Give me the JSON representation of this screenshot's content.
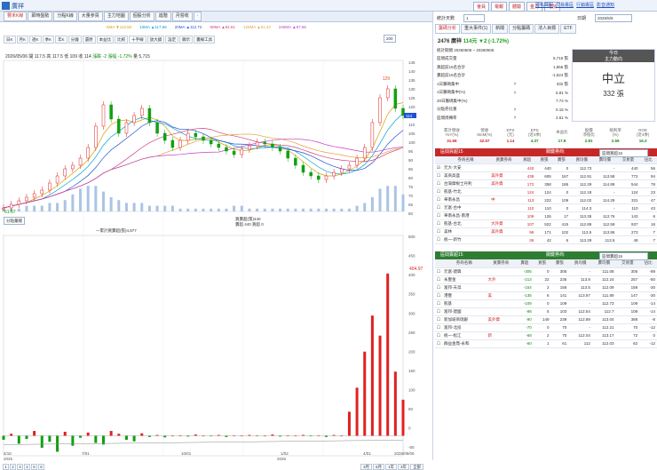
{
  "topbar": {
    "app_name": "廣祥",
    "actions": [
      "會員",
      "電報",
      "體驗",
      "金力",
      "增加"
    ],
    "links": [
      "隱私聲明",
      "交易專區",
      "行銷專區",
      "影音通知"
    ]
  },
  "left": {
    "tabs": [
      "豐禾K線",
      "即時盤勢",
      "分點K線",
      "大量參買",
      "主力地圖",
      "個股分析",
      "進階",
      "月營收",
      "·"
    ],
    "ma": [
      {
        "label": "5MA ▼113.50",
        "color": "#d8a000"
      },
      {
        "label": "10MA ▲117.65",
        "color": "#00a0d0"
      },
      {
        "label": "20MA ▲112.72",
        "color": "#2050d0"
      },
      {
        "label": "60MA ▲92.61",
        "color": "#d04080"
      },
      {
        "label": "120MA ▲91.42",
        "color": "#e0a030"
      },
      {
        "label": "240MA ▲87.56",
        "color": "#c040c0"
      }
    ],
    "tools": [
      "日K",
      "月K",
      "週K",
      "季K",
      "年K",
      "分鐘",
      "還原",
      "本益比",
      "比較",
      "十字線",
      "放大鏡",
      "設定",
      "顯示",
      "畫線工具"
    ],
    "info": {
      "date": "2026/05/06",
      "open": "開 117.5",
      "high": "高 117.5",
      "low": "低 109",
      "close": "收 114",
      "change": "漲跌 -2",
      "pct": "漲幅 -1.72%",
      "vol": "量 5,715"
    },
    "days_select": "200",
    "price_ticks": [
      "145",
      "140",
      "135",
      "130",
      "125",
      "120",
      "115",
      "110",
      "105",
      "100",
      "95",
      "90",
      "85",
      "80",
      "75",
      "70",
      "65",
      "60"
    ],
    "max_label": "129",
    "min_label": "61.67",
    "last_price_label": "114",
    "volume_ticks": [
      "10K",
      "5K"
    ],
    "indicator_select": "分點彙總",
    "indicator_lines": [
      "一累計買賣超(張)4,877",
      "買賣超(張)440",
      "賣超 440 買超 0"
    ],
    "sub_ticks": [
      "500",
      "450",
      "400",
      "350",
      "300",
      "250",
      "200",
      "150",
      "100",
      "50",
      "0",
      "-50"
    ],
    "sub_value_label": "404.97",
    "date_ticks": [
      "4/18",
      "7/01",
      "10/01",
      "1/02",
      "4/01",
      "2026/05/06"
    ],
    "year_labels": [
      "2025",
      "2026"
    ],
    "pages": [
      "1",
      "2",
      "3",
      "4",
      "5",
      "6"
    ],
    "ranges": [
      "3月",
      "6月",
      "1年",
      "3年",
      "全部"
    ]
  },
  "right": {
    "days_label": "統計天數",
    "days_value": "1",
    "date_label": "日期",
    "date_value": "2026/5/6",
    "tabs": [
      "籌碼分析",
      "重大事件(1)",
      "新聞",
      "分點籌碼",
      "法人目標",
      "ETF"
    ],
    "stock": {
      "code": "2476 廣祥",
      "price": "114元",
      "change": "▼2 (-1.72%)"
    },
    "volume_rows": [
      [
        "統計期間 20260506 ~ 20260506",
        "",
        ""
      ],
      [
        "區間成交量",
        "",
        "5,715 張"
      ],
      [
        "買超前15名合計",
        "",
        "1,856 張"
      ],
      [
        "賣超前15名合計",
        "",
        "-1,524 張"
      ],
      [
        "1日籌碼集中",
        "?",
        "332 張"
      ],
      [
        "1日籌碼集中(%)",
        "?",
        "5.81 %"
      ],
      [
        "20日籌碼集中(%)",
        "",
        "7.74 %"
      ],
      [
        "分點券比重",
        "?",
        "0.15 %"
      ],
      [
        "區間周轉率",
        "?",
        "2.61 %"
      ]
    ],
    "today_box": {
      "title1": "今日",
      "title2": "主力動向",
      "state": "中立",
      "value": "332 張"
    },
    "stats_headers": [
      "累計營收\nYoY(%)",
      "營收\nMoM(%)",
      "EPS\n(元)",
      "EPS\n(近4季)",
      "本益比",
      "股價\n淨值比",
      "殖利率\n(%)",
      "ROE\n(近4季)"
    ],
    "stats_values": [
      "31.66",
      "42.57",
      "1.14",
      "4.37",
      "17.8",
      "2.81",
      "2.59",
      "16.3"
    ],
    "buy_title": "區間買超15",
    "sell_title": "區間賣超15",
    "rank_selector": "關鍵券商:",
    "rank_select_value": "區間買超15",
    "sell_select_value": "區間賣超15",
    "buy_headers": [
      "",
      "券商名稱",
      "買賣券商",
      "買超",
      "買張",
      "賣張",
      "買均價",
      "賣均價",
      "交易量",
      "佔比"
    ],
    "buy_rows": [
      [
        "☑",
        "元大-大安",
        "",
        "440",
        "440",
        "0",
        "112.73",
        "-",
        "440",
        "56"
      ],
      [
        "☐",
        "美商高盛",
        "美外資",
        "438",
        "605",
        "167",
        "112.91",
        "113.58",
        "772",
        "94"
      ],
      [
        "☐",
        "台灣摩根士丹利",
        "美外資",
        "172",
        "358",
        "186",
        "112.29",
        "114.89",
        "544",
        "78"
      ],
      [
        "☐",
        "凱基-竹北",
        "",
        "124",
        "124",
        "0",
        "112.18",
        "-",
        "124",
        "23"
      ],
      [
        "☐",
        "華南永昌",
        "中",
        "113",
        "222",
        "109",
        "112.02",
        "114.29",
        "331",
        "47"
      ],
      [
        "☐",
        "元富-台中",
        "",
        "110",
        "110",
        "0",
        "114.3",
        "-",
        "110",
        "43"
      ],
      [
        "☐",
        "華南永昌-南港",
        "",
        "109",
        "126",
        "17",
        "113.35",
        "113.76",
        "143",
        "6"
      ],
      [
        "☐",
        "凱基-台北",
        "大外資",
        "107",
        "522",
        "415",
        "112.89",
        "112.59",
        "937",
        "16"
      ],
      [
        "☐",
        "美林",
        "美外資",
        "99",
        "171",
        "102",
        "113.5",
        "113.86",
        "273",
        "7"
      ],
      [
        "☐",
        "統一-新竹",
        "",
        "36",
        "42",
        "6",
        "113.29",
        "113.5",
        "48",
        "7"
      ]
    ],
    "sell_headers": [
      "",
      "券商名稱",
      "買賣券商",
      "賣超",
      "買張",
      "賣張",
      "買均價",
      "賣均價",
      "交易量",
      "佔比"
    ],
    "sell_rows": [
      [
        "☐",
        "元富-建興",
        "",
        "-305",
        "0",
        "305",
        "-",
        "111.08",
        "305",
        "-89"
      ],
      [
        "☐",
        "永豐金",
        "大外",
        "-213",
        "22",
        "235",
        "113.8",
        "112.24",
        "257",
        "-50"
      ],
      [
        "☐",
        "富邦-天母",
        "",
        "-154",
        "2",
        "156",
        "113.5",
        "112.09",
        "158",
        "-30"
      ],
      [
        "☐",
        "港豐",
        "美",
        "-135",
        "6",
        "141",
        "113.67",
        "111.89",
        "147",
        "-30"
      ],
      [
        "☐",
        "凱基",
        "",
        "-109",
        "0",
        "109",
        "-",
        "112.73",
        "109",
        "-14"
      ],
      [
        "☐",
        "富邦-建國",
        "",
        "-98",
        "5",
        "103",
        "112.54",
        "112.7",
        "108",
        "-14"
      ],
      [
        "☐",
        "新加坡商瑞銀",
        "美外資",
        "-90",
        "149",
        "239",
        "112.89",
        "113.04",
        "388",
        "-8"
      ],
      [
        "☐",
        "富邦-北投",
        "",
        "-70",
        "0",
        "70",
        "-",
        "112.21",
        "70",
        "-12"
      ],
      [
        "☐",
        "統一-松江",
        "新",
        "-68",
        "2",
        "70",
        "112.04",
        "113.17",
        "72",
        "0"
      ],
      [
        "☐",
        "群益金鼎-永和",
        "",
        "-60",
        "1",
        "61",
        "112",
        "112.03",
        "62",
        "-12"
      ]
    ]
  },
  "chart_data": {
    "type": "line",
    "title": "",
    "xlabel": "",
    "ylabel": "",
    "ylim": [
      60,
      145
    ],
    "date_labels": [
      "4/18",
      "7/01",
      "10/01",
      "1/02",
      "4/01",
      "2026/05/06"
    ],
    "price_series": [
      62,
      64,
      66,
      68,
      70,
      72,
      76,
      80,
      84,
      86,
      90,
      96,
      108,
      120,
      112,
      104,
      110,
      114,
      118,
      110,
      104,
      100,
      96,
      100,
      104,
      102,
      100,
      98,
      96,
      94,
      92,
      95,
      97,
      99,
      98,
      96,
      94,
      90,
      86,
      82,
      80,
      78,
      80,
      82,
      84,
      86,
      90,
      96,
      110,
      124,
      129,
      118,
      114
    ],
    "volume_scale": [
      1,
      1,
      1,
      2,
      2,
      2,
      3,
      3,
      4,
      6,
      8,
      9,
      9,
      7,
      5,
      4,
      3,
      3,
      3,
      2,
      2,
      2,
      2,
      1,
      1,
      1,
      1,
      1,
      1,
      1,
      2,
      2,
      1,
      1,
      1,
      1,
      1,
      1,
      1,
      1,
      1,
      1,
      1,
      1,
      1,
      1,
      2,
      3,
      5,
      8,
      9,
      9,
      6
    ],
    "sub_values": [
      -10,
      5,
      -20,
      -8,
      12,
      -30,
      -15,
      -40,
      10,
      -25,
      -5,
      8,
      -18,
      -22,
      12,
      5,
      -10,
      -14,
      6,
      -3,
      2,
      -4,
      0,
      1,
      -2,
      3,
      0,
      -1,
      2,
      -3,
      1,
      0,
      2,
      -1,
      0,
      3,
      -2,
      1,
      0,
      2,
      -1,
      1,
      -3,
      2,
      0,
      60,
      120,
      210,
      300,
      250,
      404.97,
      160,
      90
    ],
    "sub_ylim": [
      -50,
      500
    ]
  }
}
